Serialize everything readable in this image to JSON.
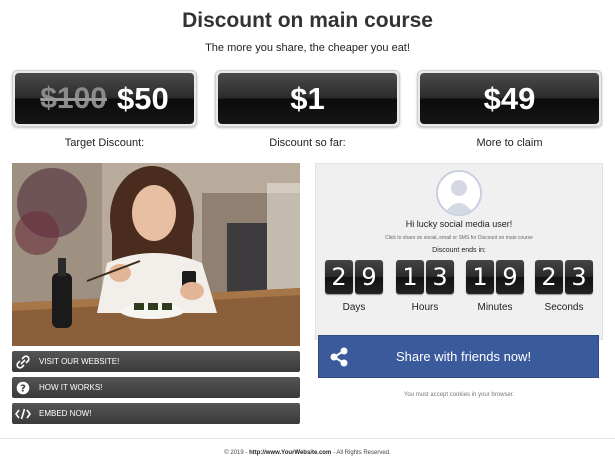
{
  "header": {
    "title": "Discount on main course",
    "subtitle": "The more you share, the cheaper you eat!"
  },
  "prices": [
    {
      "old": "$100",
      "value": "$50",
      "label": "Target Discount:"
    },
    {
      "old": "",
      "value": "$1",
      "label": "Discount so far:"
    },
    {
      "old": "",
      "value": "$49",
      "label": "More to claim"
    }
  ],
  "photo": {
    "icon": "woman-with-phone-photo"
  },
  "side_buttons": [
    {
      "label": "VISIT OUR WEBSITE!",
      "icon": "link-icon"
    },
    {
      "label": "HOW IT WORKS!",
      "icon": "question-icon"
    },
    {
      "label": "EMBED NOW!",
      "icon": "code-icon"
    }
  ],
  "panel": {
    "greeting": "Hi lucky social media user!",
    "hint": "Click to share on social, email or SMS for Discount on main course",
    "ends_label": "Discount ends in:",
    "countdown": [
      {
        "digits": [
          "2",
          "9"
        ],
        "label": "Days"
      },
      {
        "digits": [
          "1",
          "3"
        ],
        "label": "Hours"
      },
      {
        "digits": [
          "1",
          "9"
        ],
        "label": "Minutes"
      },
      {
        "digits": [
          "2",
          "3"
        ],
        "label": "Seconds"
      }
    ]
  },
  "share_button": {
    "label": "Share with friends now!",
    "icon": "share-icon",
    "color": "#3b5a9c"
  },
  "cookie_notice": "You must accept cookies in your browser.",
  "footer": {
    "prefix": "© 2019 -",
    "link": "http://www.YourWebsite.com",
    "suffix": "- All Rights Reserved."
  }
}
